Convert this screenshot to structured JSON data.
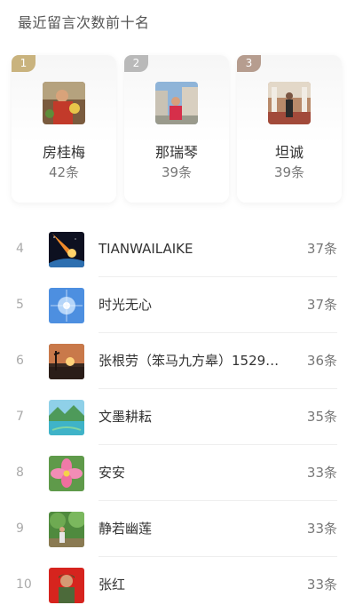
{
  "header": {
    "title": "最近留言次数前十名"
  },
  "top3": [
    {
      "rank": "1",
      "name": "房桂梅",
      "count": "42条",
      "tag_color": "#c9b37e"
    },
    {
      "rank": "2",
      "name": "那瑞琴",
      "count": "39条",
      "tag_color": "#b9b9b9"
    },
    {
      "rank": "3",
      "name": "坦诚",
      "count": "39条",
      "tag_color": "#b69d8f"
    }
  ],
  "list": [
    {
      "rank": "4",
      "name": "TIANWAILAIKE",
      "count": "37条"
    },
    {
      "rank": "5",
      "name": "时光无心",
      "count": "37条"
    },
    {
      "rank": "6",
      "name": "张根劳（笨马九方皋）1529…",
      "count": "36条"
    },
    {
      "rank": "7",
      "name": "文墨耕耘",
      "count": "35条"
    },
    {
      "rank": "8",
      "name": "安安",
      "count": "33条"
    },
    {
      "rank": "9",
      "name": "静若幽莲",
      "count": "33条"
    },
    {
      "rank": "10",
      "name": "张红",
      "count": "33条"
    }
  ]
}
